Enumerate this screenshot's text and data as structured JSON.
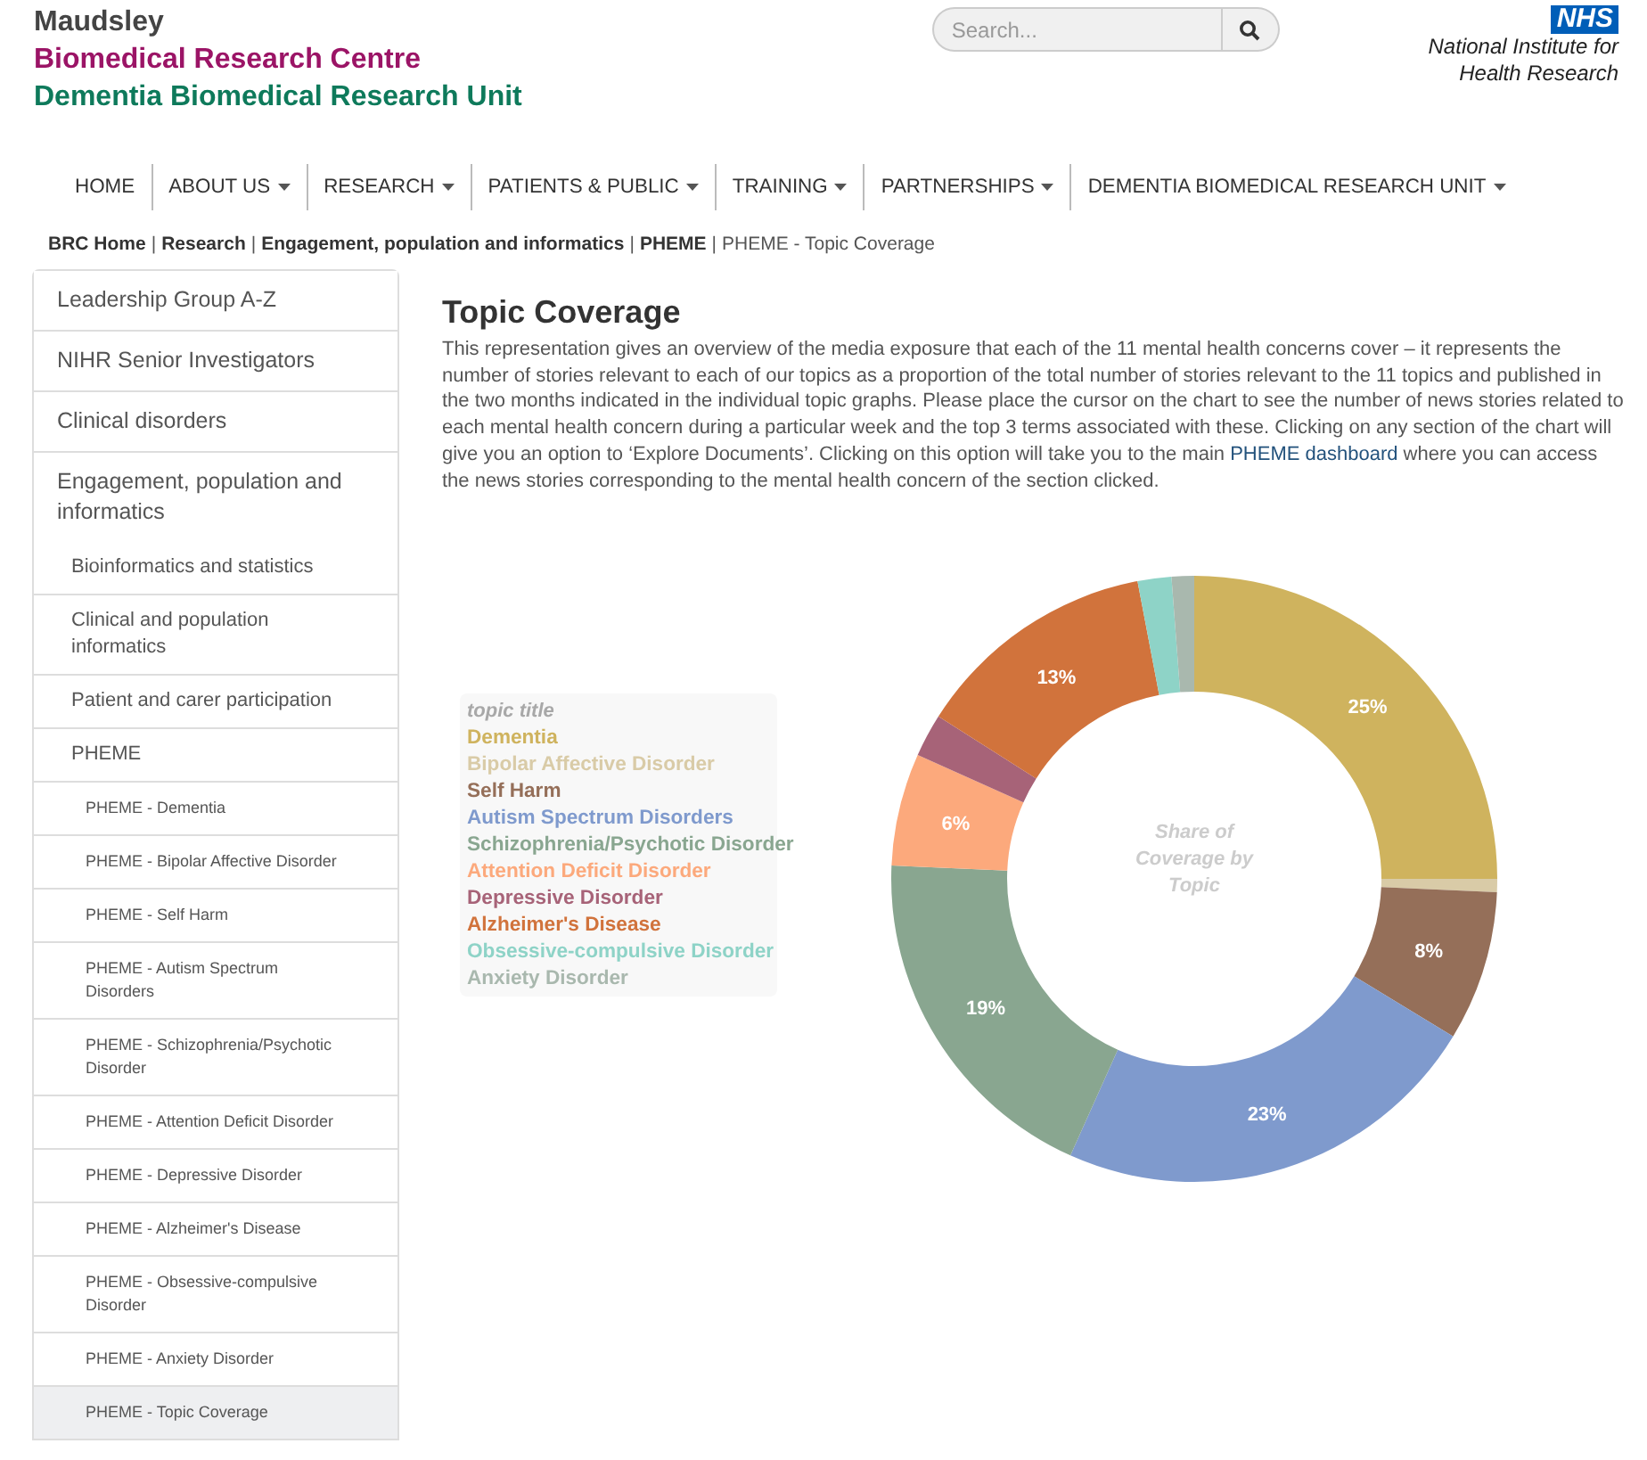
{
  "header": {
    "org_lines": [
      "Maudsley",
      "Biomedical Research Centre",
      "Dementia Biomedical Research Unit"
    ],
    "search": {
      "placeholder": "Search..."
    },
    "logo_badge": "NHS",
    "logo_lines": [
      "National Institute for",
      "Health Research"
    ]
  },
  "nav": [
    {
      "label": "HOME",
      "dropdown": false
    },
    {
      "label": "ABOUT US",
      "dropdown": true
    },
    {
      "label": "RESEARCH",
      "dropdown": true
    },
    {
      "label": "PATIENTS & PUBLIC",
      "dropdown": true
    },
    {
      "label": "TRAINING",
      "dropdown": true
    },
    {
      "label": "PARTNERSHIPS",
      "dropdown": true
    },
    {
      "label": "DEMENTIA BIOMEDICAL RESEARCH UNIT",
      "dropdown": true
    }
  ],
  "breadcrumb": {
    "separator": "|",
    "links": [
      "BRC Home",
      "Research",
      "Engagement, population and informatics",
      "PHEME"
    ],
    "current": "PHEME - Topic Coverage"
  },
  "sidebar": {
    "items": [
      {
        "label": "Leadership Group A-Z",
        "selected": false
      },
      {
        "label": "NIHR Senior Investigators",
        "selected": false
      },
      {
        "label": "Clinical disorders",
        "selected": false
      },
      {
        "label": "Engagement, population and informatics",
        "selected": false,
        "children": [
          {
            "label": "Bioinformatics and statistics",
            "selected": false
          },
          {
            "label": "Clinical and population informatics",
            "selected": false
          },
          {
            "label": "Patient and carer participation",
            "selected": false
          },
          {
            "label": "PHEME",
            "selected": false,
            "children": [
              {
                "label": "PHEME - Dementia",
                "selected": false
              },
              {
                "label": "PHEME - Bipolar Affective Disorder",
                "selected": false
              },
              {
                "label": "PHEME - Self Harm",
                "selected": false
              },
              {
                "label": "PHEME - Autism Spectrum Disorders",
                "selected": false
              },
              {
                "label": "PHEME - Schizophrenia/Psychotic Disorder",
                "selected": false
              },
              {
                "label": "PHEME - Attention Deficit Disorder",
                "selected": false
              },
              {
                "label": "PHEME - Depressive Disorder",
                "selected": false
              },
              {
                "label": "PHEME - Alzheimer's Disease",
                "selected": false
              },
              {
                "label": "PHEME - Obsessive-compulsive Disorder",
                "selected": false
              },
              {
                "label": "PHEME - Anxiety Disorder",
                "selected": false
              },
              {
                "label": "PHEME - Topic Coverage",
                "selected": true
              }
            ]
          }
        ]
      }
    ]
  },
  "main": {
    "title": "Topic Coverage",
    "intro_before": "This representation gives an overview of the media exposure that each of the 11 mental health concerns cover – it represents the number of stories relevant to each of our topics as a proportion of the total number of stories relevant to the 11 topics and published in the two months indicated in the individual topic graphs. Please place the cursor on the chart to see the number of news stories related to each mental health concern during a particular week and the top 3 terms associated with these. Clicking on any section of the chart will give you an option to ‘Explore Documents’. Clicking on this option will take you to the main",
    "intro_link": "PHEME dashboard",
    "intro_after": "where you can access the news stories corresponding to the mental health concern of the section clicked.",
    "legend": {
      "title": "topic title",
      "items": [
        {
          "label": "Dementia",
          "color": "#cfb35e"
        },
        {
          "label": "Bipolar Affective Disorder",
          "color": "#d9cba7"
        },
        {
          "label": "Self Harm",
          "color": "#956f59"
        },
        {
          "label": "Autism Spectrum Disorders",
          "color": "#7f9acd"
        },
        {
          "label": "Schizophrenia/Psychotic Disorder",
          "color": "#89a690"
        },
        {
          "label": "Attention Deficit Disorder",
          "color": "#fca97c"
        },
        {
          "label": "Depressive Disorder",
          "color": "#a76378"
        },
        {
          "label": "Alzheimer's Disease",
          "color": "#d1733c"
        },
        {
          "label": "Obsessive-compulsive Disorder",
          "color": "#8ed3c7"
        },
        {
          "label": "Anxiety Disorder",
          "color": "#a9b8ae"
        }
      ]
    },
    "chart_data": {
      "type": "donut",
      "title": "Share of Coverage by Topic",
      "colors": [
        "#cfb35e",
        "#d9cba7",
        "#956f59",
        "#7f9acd",
        "#89a690",
        "#fca97c",
        "#a76378",
        "#d1733c",
        "#8ed3c7",
        "#a9b8ae"
      ],
      "values": [
        25,
        0.7,
        8,
        23,
        19,
        6,
        2.3,
        13,
        1.8,
        1.2
      ],
      "value_labels": [
        "25%",
        null,
        "8%",
        "23%",
        "19%",
        "6%",
        null,
        "13%",
        null,
        null
      ]
    }
  }
}
